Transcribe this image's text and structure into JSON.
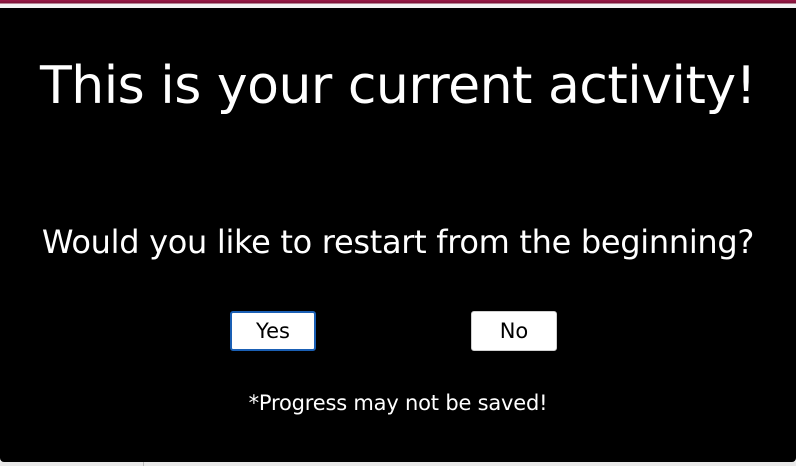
{
  "dialog": {
    "title": "This is your current activity!",
    "question": "Would you like to restart from the beginning?",
    "yes_label": "Yes",
    "no_label": "No",
    "note": "*Progress may not be saved!"
  },
  "colors": {
    "background": "#000000",
    "text": "#ffffff",
    "button_background": "#ffffff",
    "focus_border": "#1a5fb4",
    "accent_top": "#9b1a48"
  }
}
